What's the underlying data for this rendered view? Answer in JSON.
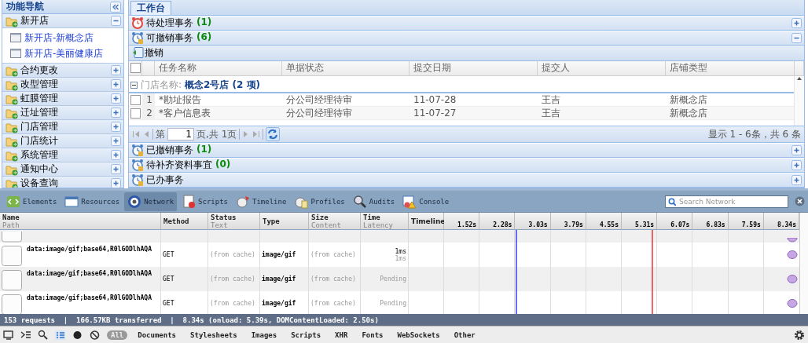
{
  "sidebar": {
    "title": "功能导航",
    "groups": [
      {
        "label": "新开店",
        "expanded": true,
        "children": [
          {
            "label": "新开店-新概念店"
          },
          {
            "label": "新开店-美丽健康店"
          }
        ]
      },
      {
        "label": "合约更改",
        "expanded": false
      },
      {
        "label": "改型管理",
        "expanded": false
      },
      {
        "label": "虹膜管理",
        "expanded": false
      },
      {
        "label": "迁址管理",
        "expanded": false
      },
      {
        "label": "门店管理",
        "expanded": false
      },
      {
        "label": "门店统计",
        "expanded": false
      },
      {
        "label": "系统管理",
        "expanded": false
      },
      {
        "label": "通知中心",
        "expanded": false
      },
      {
        "label": "设备查询",
        "expanded": false
      }
    ]
  },
  "tabs": [
    {
      "label": "工作台",
      "selected": true
    }
  ],
  "panels": [
    {
      "kind": "alarm",
      "title": "待处理事务",
      "count": "(1)",
      "expanded": false
    },
    {
      "kind": "clock",
      "title": "可撤销事务",
      "count": "(6)",
      "expanded": true,
      "toolbar": {
        "button": "撤销"
      },
      "grid": {
        "select_all": false,
        "columns": [
          "任务名称",
          "单据状态",
          "提交日期",
          "提交人",
          "店铺类型"
        ],
        "groups": [
          {
            "label": "门店名称:",
            "value": "概念2号店 (2 项)",
            "expanded": true,
            "rows": [
              {
                "number": "1",
                "checked": false,
                "cells": [
                  "*勘址报告",
                  "分公司经理待审",
                  "11-07-28",
                  "王吉",
                  "新概念店"
                ]
              },
              {
                "number": "2",
                "checked": false,
                "cells": [
                  "*客户信息表",
                  "分公司经理待审",
                  "11-07-27",
                  "王吉",
                  "新概念店"
                ]
              }
            ]
          }
        ]
      },
      "pager": {
        "before": "第",
        "page": "1",
        "after": "页,共 1页",
        "info": "显示 1 - 6条，共 6 条"
      }
    },
    {
      "kind": "clock",
      "title": "已撤销事务",
      "count": "(1)",
      "expanded": false
    },
    {
      "kind": "clock",
      "title": "待补齐资料事宜",
      "count": "(0)",
      "expanded": false
    },
    {
      "kind": "clock",
      "title": "已办事务",
      "expanded": false
    }
  ],
  "devtools": {
    "panels": [
      {
        "label": "Elements",
        "selected": false
      },
      {
        "label": "Resources",
        "selected": false
      },
      {
        "label": "Network",
        "selected": true
      },
      {
        "label": "Scripts",
        "selected": false
      },
      {
        "label": "Timeline",
        "selected": false
      },
      {
        "label": "Profiles",
        "selected": false
      },
      {
        "label": "Audits",
        "selected": false
      },
      {
        "label": "Console",
        "selected": false
      }
    ],
    "search": {
      "placeholder": "Search Network"
    },
    "columns": [
      {
        "title": "Name",
        "subtitle": "Path"
      },
      {
        "title": "Method"
      },
      {
        "title": "Status",
        "subtitle": "Text"
      },
      {
        "title": "Type"
      },
      {
        "title": "Size",
        "subtitle": "Content"
      },
      {
        "title": "Time",
        "subtitle": "Latency"
      },
      {
        "title": "Timeline"
      }
    ],
    "ticks": [
      "1.52s",
      "2.28s",
      "3.03s",
      "3.79s",
      "4.55s",
      "5.31s",
      "6.07s",
      "6.83s",
      "7.59s",
      "8.34s"
    ],
    "requests": [
      {
        "name": "data:image/gif;base64,R0lGODlhAQA",
        "method": "GET",
        "status": "(from cache)",
        "type": "image/gif",
        "size": "(from cache)",
        "time": "1ms",
        "latency": "1ms"
      },
      {
        "name": "data:image/gif;base64,R0lGODlhAQA",
        "method": "GET",
        "status": "(from cache)",
        "type": "image/gif",
        "size": "(from cache)",
        "time": "Pending"
      },
      {
        "name": "data:image/gif;base64,R0lGODlhAQA",
        "method": "GET",
        "status": "(from cache)",
        "type": "image/gif",
        "size": "(from cache)",
        "time": "Pending"
      }
    ],
    "summary": "153 requests  |  166.57KB transferred  |  8.34s (onload: 5.39s, DOMContentLoaded: 2.50s)",
    "filters": [
      {
        "label": "All",
        "selected": true
      },
      {
        "label": "Documents",
        "selected": false
      },
      {
        "label": "Stylesheets",
        "selected": false
      },
      {
        "label": "Images",
        "selected": false
      },
      {
        "label": "Scripts",
        "selected": false
      },
      {
        "label": "XHR",
        "selected": false
      },
      {
        "label": "Fonts",
        "selected": false
      },
      {
        "label": "WebSockets",
        "selected": false
      },
      {
        "label": "Other",
        "selected": false
      }
    ]
  }
}
